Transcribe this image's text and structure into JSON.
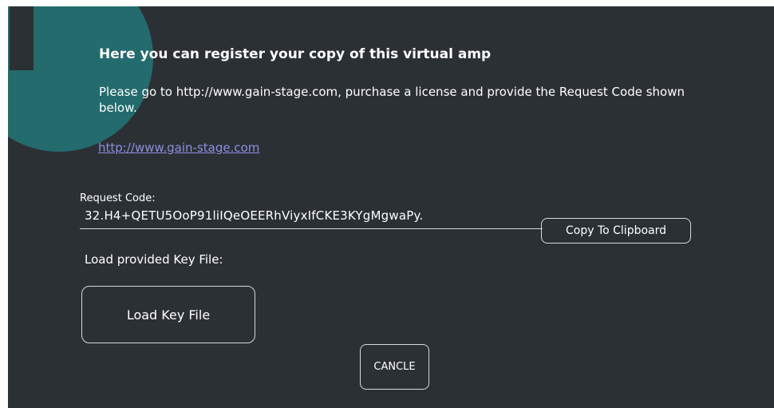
{
  "dialog": {
    "title": "Here you can register your copy of this virtual amp",
    "message": "Please go to http://www.gain-stage.com, purchase a license and provide the Request Code shown below.",
    "link_text": "http://www.gain-stage.com",
    "request_code_label": "Request Code:",
    "request_code_value": "32.H4+QETU5OoP91liIQeOEERhViyxIfCKE3KYgMgwaPy.",
    "copy_button_label": "Copy To Clipboard",
    "load_label": "Load provided Key File:",
    "load_button_label": "Load Key File",
    "cancel_button_label": "CANCLE"
  },
  "icons": {
    "badge": "info-icon"
  },
  "colors": {
    "dialog_background": "#2b3035",
    "badge": "#236b6d",
    "link": "#8f8fe0",
    "text": "#ffffff"
  }
}
